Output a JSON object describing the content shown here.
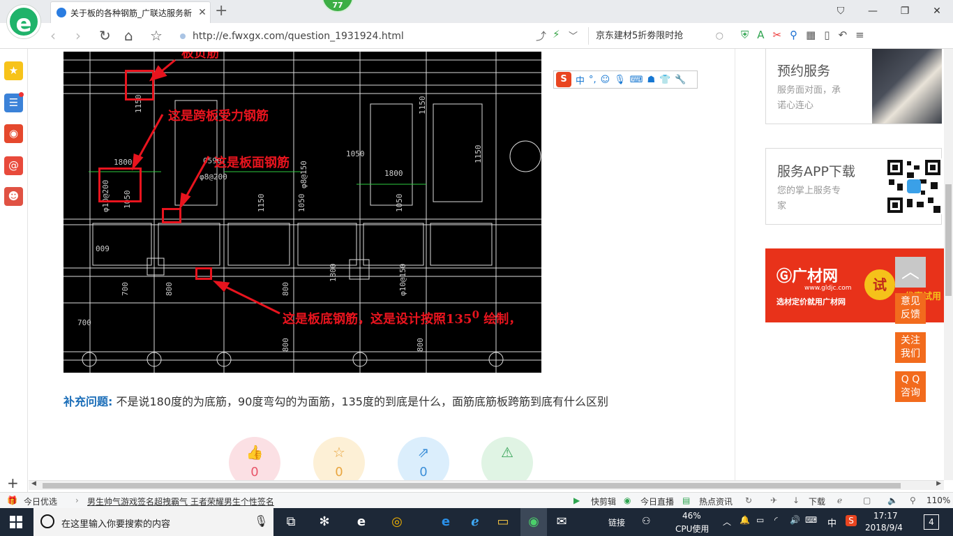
{
  "browser": {
    "tab_title": "关于板的各种钢筋_广联达服务新",
    "badge_count": "77",
    "url": "http://e.fwxgx.com/question_1931924.html",
    "search_box": "京东建材5折劵限时抢",
    "zoom": "110%"
  },
  "drawing": {
    "annotations": {
      "neg_rebar": "板负筋",
      "span_rebar": "这是跨板受力钢筋",
      "top_rebar": "这是板面钢筋",
      "bottom_rebar_a": "这是板底钢筋，这是设计按照135",
      "bottom_rebar_sup": "0",
      "bottom_rebar_b": " 绘制，"
    },
    "labels": {
      "l1150a": "1150",
      "l1800a": "1800",
      "l1800b": "1800",
      "l1050a": "1050",
      "l1050b": "1050",
      "l1150b": "1150",
      "l1150c": "1150",
      "l700a": "700",
      "l800a": "800",
      "l800b": "800",
      "l800c": "800",
      "l700b": "700",
      "l800d": "800",
      "l009": "009",
      "l1050c": "1050",
      "l1050d": "1050",
      "l1800c": "1800",
      "l1150d": "1150",
      "l10200": "φ10@200",
      "l8200": "φ8@200",
      "l8150": "φ8@150",
      "l10150": "φ10@150",
      "l0590": "0590"
    }
  },
  "ime_toolbar": {
    "s_label": "S",
    "lang": "中",
    "punct": "°,"
  },
  "supplement": {
    "label": "补充问题:",
    "text": "不是说180度的为底筋，90度弯勾的为面筋，135度的到底是什么，面筋底筋板跨筋到底有什么区别"
  },
  "actions": [
    {
      "name": "like",
      "count": "0",
      "color": "#fbe0e4",
      "fg": "#e8566a"
    },
    {
      "name": "favorite",
      "count": "0",
      "color": "#fdf0d6",
      "fg": "#e9a640"
    },
    {
      "name": "share",
      "count": "0",
      "color": "#dbeefc",
      "fg": "#3d8fd8"
    },
    {
      "name": "report",
      "count": "",
      "color": "#e0f4e4",
      "fg": "#3aa55a"
    }
  ],
  "right": {
    "card1": {
      "title": "预约服务",
      "desc1": "服务面对面，承",
      "desc2": "诺心连心"
    },
    "card2": {
      "title": "服务APP下载",
      "desc1": "您的掌上服务专",
      "desc2": "家"
    },
    "ad": {
      "brand": "广材网",
      "site": "www.gldjc.com",
      "slogan": "选材定价就用广材网",
      "try": "试",
      "partial": "优惠试用",
      "p": "P"
    }
  },
  "float_buttons": {
    "feedback1": "意见",
    "feedback2": "反馈",
    "follow1": "关注",
    "follow2": "我们",
    "qq1": "Q Q",
    "qq2": "咨询"
  },
  "statusbar": {
    "today": "今日优选",
    "news": "男生帅气游戏签名超拽霸气 王者荣耀男生个性签名",
    "kuaijian": "快剪辑",
    "live": "今日直播",
    "hot": "热点资讯",
    "download": "下载",
    "zoom": "110%"
  },
  "taskbar": {
    "search_placeholder": "在这里输入你要搜索的内容",
    "link": "链接",
    "cpu_pct": "46%",
    "cpu_label": "CPU使用",
    "ime": "中",
    "time": "17:17",
    "date": "2018/9/4",
    "notif": "4"
  }
}
